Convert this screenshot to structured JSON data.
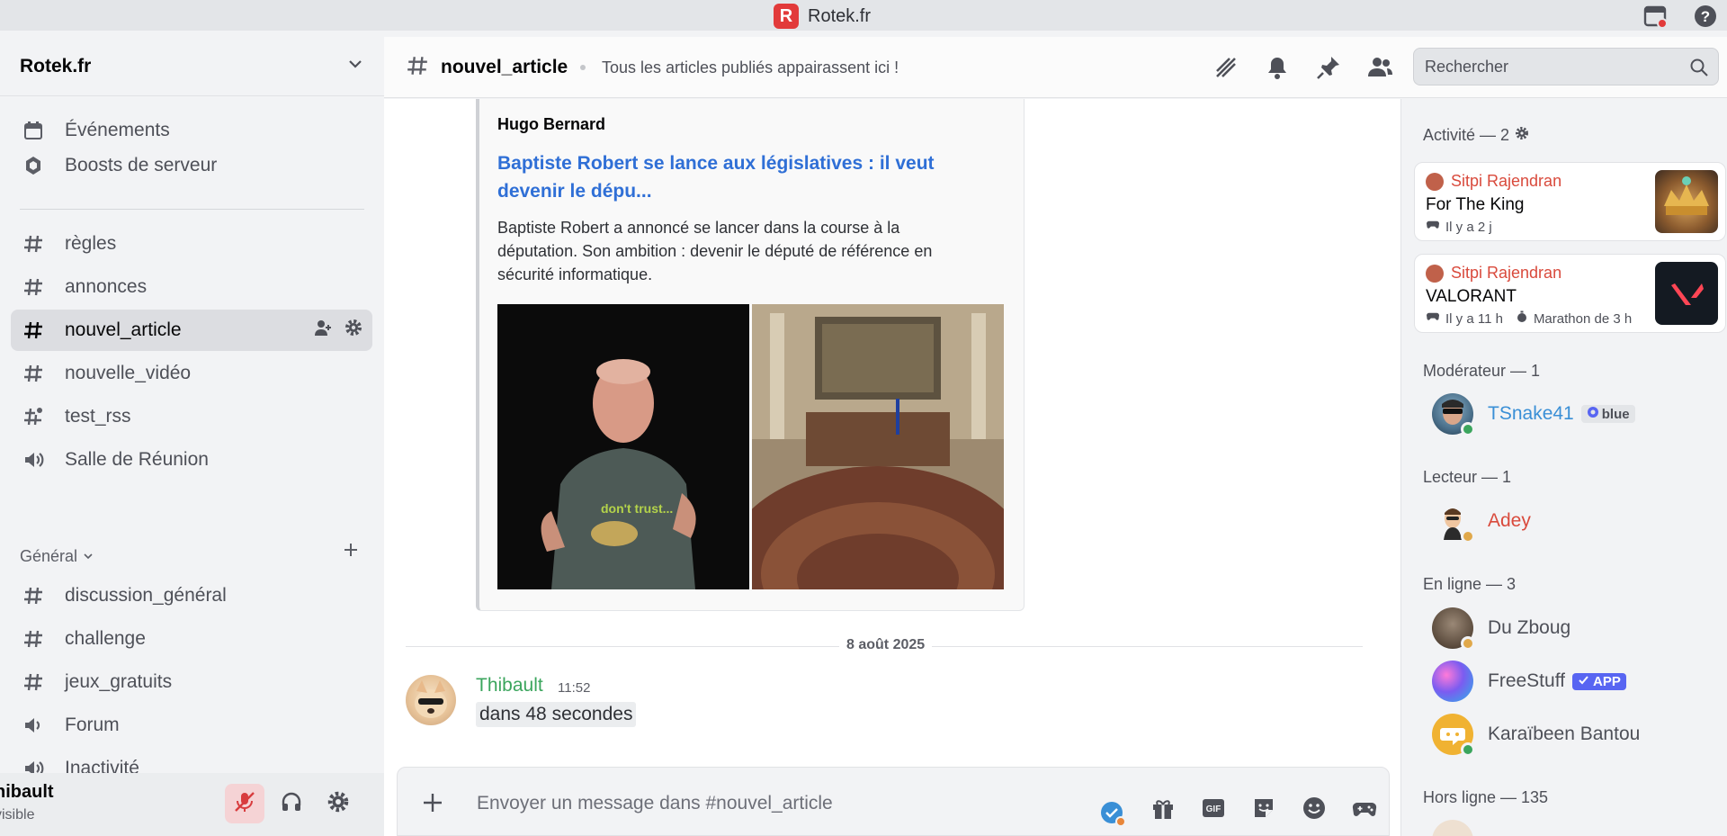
{
  "window": {
    "title": "Rotek.fr",
    "logo_letter": "R"
  },
  "server": {
    "name": "Rotek.fr"
  },
  "sidebar": {
    "top_items": [
      {
        "label": "Événements",
        "icon": "calendar-icon"
      },
      {
        "label": "Boosts de serveur",
        "icon": "boost-icon"
      }
    ],
    "channels": [
      {
        "label": "règles",
        "icon": "hash-icon"
      },
      {
        "label": "annonces",
        "icon": "hash-icon"
      },
      {
        "label": "nouvel_article",
        "icon": "hash-icon",
        "active": true
      },
      {
        "label": "nouvelle_vidéo",
        "icon": "hash-icon"
      },
      {
        "label": "test_rss",
        "icon": "hash-feed-icon"
      },
      {
        "label": "Salle de Réunion",
        "icon": "voice-icon"
      }
    ],
    "category": "Général",
    "category_channels": [
      {
        "label": "discussion_général",
        "icon": "hash-icon"
      },
      {
        "label": "challenge",
        "icon": "hash-icon"
      },
      {
        "label": "jeux_gratuits",
        "icon": "hash-icon"
      },
      {
        "label": "Forum",
        "icon": "voice-icon"
      },
      {
        "label": "Inactivité",
        "icon": "voice-icon"
      }
    ]
  },
  "user_panel": {
    "name": "hibault",
    "status": "visible"
  },
  "header": {
    "channel": "nouvel_article",
    "topic": "Tous les articles publiés appairassent ici !",
    "search_placeholder": "Rechercher"
  },
  "embed": {
    "author": "Hugo Bernard",
    "title": "Baptiste Robert se lance aux législatives : il veut devenir le dépu...",
    "description": "Baptiste Robert a annoncé se lancer dans la course à la députation. Son ambition : devenir le député de référence en sécurité informatique.",
    "shirt_text": "don't trust..."
  },
  "date_separator": "8 août 2025",
  "message": {
    "author": "Thibault",
    "time": "11:52",
    "text": "dans 48 secondes"
  },
  "composer": {
    "placeholder": "Envoyer un message dans #nouvel_article",
    "gif_label": "GIF"
  },
  "members": {
    "activity_header": "Activité — 2",
    "activities": [
      {
        "user": "Sitpi Rajendran",
        "game": "For The King",
        "meta": "Il y a 2 j",
        "extra": ""
      },
      {
        "user": "Sitpi Rajendran",
        "game": "VALORANT",
        "meta": "Il y a 11 h",
        "extra": "Marathon de 3 h"
      }
    ],
    "moderator_header": "Modérateur — 1",
    "moderator": {
      "name": "TSnake41",
      "tag": "blue",
      "color": "#3a8fd6"
    },
    "reader_header": "Lecteur — 1",
    "reader": {
      "name": "Adey",
      "color": "#d94a3c"
    },
    "online_header": "En ligne — 3",
    "online": [
      {
        "name": "Du Zboug",
        "tag": ""
      },
      {
        "name": "FreeStuff",
        "tag": "APP"
      },
      {
        "name": "Karaïbeen Bantou",
        "tag": ""
      }
    ],
    "offline_header": "Hors ligne — 135"
  }
}
